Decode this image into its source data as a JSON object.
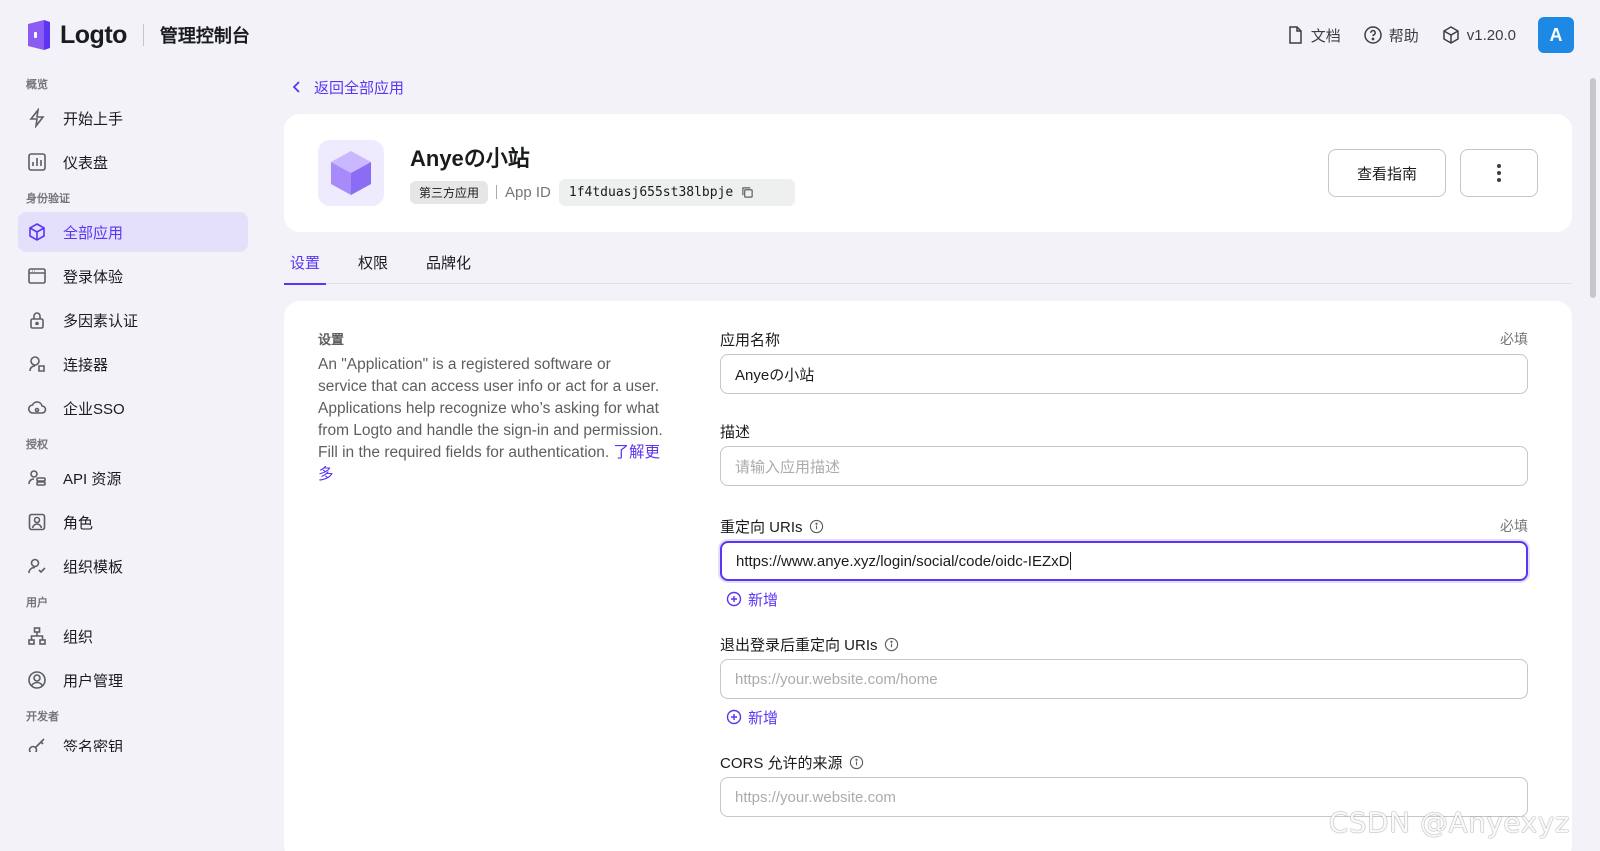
{
  "topbar": {
    "logo_text": "Logto",
    "console_title": "管理控制台",
    "docs_label": "文档",
    "help_label": "帮助",
    "version": "v1.20.0",
    "avatar_letter": "A"
  },
  "sidebar": {
    "groups": [
      {
        "title": "概览"
      },
      {
        "title": "身份验证"
      },
      {
        "title": "授权"
      },
      {
        "title": "用户"
      },
      {
        "title": "开发者"
      }
    ],
    "items": [
      {
        "label": "开始上手",
        "icon": "lightning-icon"
      },
      {
        "label": "仪表盘",
        "icon": "chart-icon"
      },
      {
        "label": "全部应用",
        "icon": "box-icon",
        "active": true
      },
      {
        "label": "登录体验",
        "icon": "window-icon"
      },
      {
        "label": "多因素认证",
        "icon": "lock-icon"
      },
      {
        "label": "连接器",
        "icon": "connector-icon"
      },
      {
        "label": "企业SSO",
        "icon": "cloud-icon"
      },
      {
        "label": "API 资源",
        "icon": "api-icon"
      },
      {
        "label": "角色",
        "icon": "role-icon"
      },
      {
        "label": "组织模板",
        "icon": "user-template-icon"
      },
      {
        "label": "组织",
        "icon": "org-icon"
      },
      {
        "label": "用户管理",
        "icon": "user-icon"
      },
      {
        "label": "签名密钥",
        "icon": "key-icon"
      }
    ]
  },
  "main": {
    "back_label": "返回全部应用",
    "app": {
      "name": "Anyeの小站",
      "tag": "第三方应用",
      "app_id_label": "App ID",
      "app_id": "1f4tduasj655st38lbpje"
    },
    "actions": {
      "guide_label": "查看指南"
    },
    "tabs": [
      {
        "label": "设置",
        "active": true
      },
      {
        "label": "权限"
      },
      {
        "label": "品牌化"
      }
    ],
    "settings": {
      "title": "设置",
      "description": "An \"Application\" is a registered software or service that can access user info or act for a user. Applications help recognize who’s asking for what from Logto and handle the sign-in and permission. Fill in the required fields for authentication.",
      "learn_more": "了解更多"
    },
    "form": {
      "app_name": {
        "label": "应用名称",
        "required": "必填",
        "value": "Anyeの小站"
      },
      "description": {
        "label": "描述",
        "placeholder": "请输入应用描述"
      },
      "redirect_uris": {
        "label": "重定向 URIs",
        "required": "必填",
        "value": "https://www.anye.xyz/login/social/code/oidc-IEZxD",
        "add_label": "新增"
      },
      "post_logout_uris": {
        "label": "退出登录后重定向 URIs",
        "placeholder": "https://your.website.com/home",
        "add_label": "新增"
      },
      "cors": {
        "label": "CORS 允许的来源",
        "placeholder": "https://your.website.com"
      }
    }
  },
  "watermark": "CSDN @Anyexyz",
  "colors": {
    "accent": "#5d34f2",
    "active_bg": "#e4e0fb",
    "page_bg": "#f3f2f8"
  }
}
